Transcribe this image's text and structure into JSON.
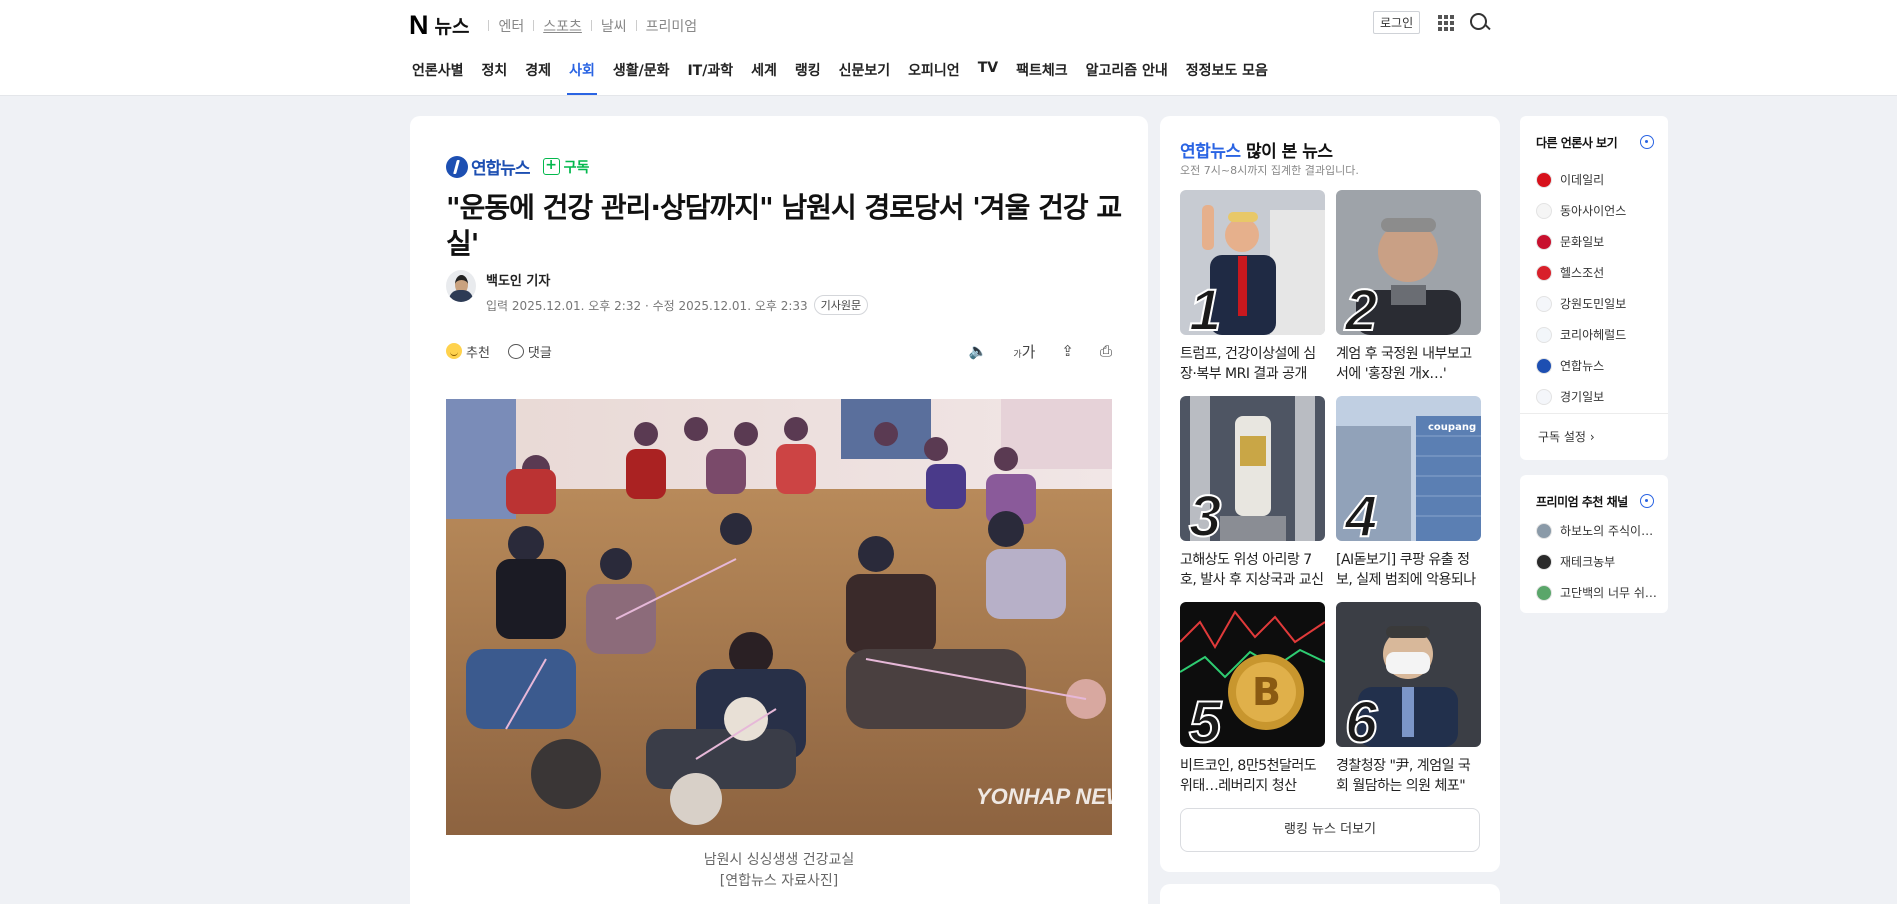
{
  "header": {
    "logo_letter": "N",
    "logo_text": "뉴스",
    "services": [
      "엔터",
      "스포츠",
      "날씨",
      "프리미엄"
    ],
    "login_label": "로그인"
  },
  "nav": {
    "tabs": [
      "언론사별",
      "정치",
      "경제",
      "사회",
      "생활/문화",
      "IT/과학",
      "세계",
      "랭킹",
      "신문보기",
      "오피니언",
      "TV",
      "팩트체크",
      "알고리즘 안내",
      "정정보도 모음"
    ],
    "active": "사회"
  },
  "article": {
    "press_name": "연합뉴스",
    "subscribe_label": "구독",
    "headline": "\"운동에 건강 관리·상담까지\" 남원시 경로당서 '겨울 건강 교실'",
    "reporter": "백도인 기자",
    "input_label": "입력",
    "input_date": "2025.12.01. 오후 2:32",
    "modified_label": "· 수정",
    "modified_date": "2025.12.01. 오후 2:33",
    "original_label": "기사원문",
    "recommend_label": "추천",
    "comment_label": "댓글",
    "font_size_label": "가",
    "photo_watermark": "YONHAP NEWS",
    "caption_line1": "남원시 싱싱생생 건강교실",
    "caption_line2": "[연합뉴스 자료사진]"
  },
  "ranking": {
    "press": "연합뉴스",
    "title_suffix": "많이 본 뉴스",
    "subtitle": "오전 7시~8시까지 집계한 결과입니다.",
    "items": [
      {
        "rank": "1",
        "title": "트럼프, 건강이상설에 심장·복부 MRI 결과 공개"
      },
      {
        "rank": "2",
        "title": "계엄 후 국정원 내부보고서에 '홍장원 개x…'"
      },
      {
        "rank": "3",
        "title": "고해상도 위성 아리랑 7호, 발사 후 지상국과 교신"
      },
      {
        "rank": "4",
        "title": "[AI돋보기] 쿠팡 유출 정보, 실제 범죄에 악용되나"
      },
      {
        "rank": "5",
        "title": "비트코인, 8만5천달러도 위태…레버리지 청산"
      },
      {
        "rank": "6",
        "title": "경찰청장 \"尹, 계엄일 국회 월담하는 의원 체포\""
      }
    ],
    "more_label": "랭킹 뉴스 더보기"
  },
  "sidebar": {
    "other_press_title": "다른 언론사 보기",
    "press_list": [
      {
        "name": "이데일리",
        "color": "#d7111b"
      },
      {
        "name": "동아사이언스",
        "color": "#f5f5f5"
      },
      {
        "name": "문화일보",
        "color": "#c8102e"
      },
      {
        "name": "헬스조선",
        "color": "#d8202a"
      },
      {
        "name": "강원도민일보",
        "color": "#f4f6fa"
      },
      {
        "name": "코리아헤럴드",
        "color": "#f2f6fa"
      },
      {
        "name": "연합뉴스",
        "color": "#1d4fb2"
      },
      {
        "name": "경기일보",
        "color": "#f4f6fa"
      }
    ],
    "settings_label": "구독 설정",
    "premium_title": "프리미엄 추천 채널",
    "premium_list": [
      {
        "name": "하보노의 주식이…",
        "color": "#8a9aa8"
      },
      {
        "name": "재테크농부",
        "color": "#2a2a2a"
      },
      {
        "name": "고단백의 너무 쉬…",
        "color": "#5aa66a"
      }
    ]
  },
  "colors": {
    "accent": "#2a64e3",
    "subscribe": "#03b84d",
    "yonhap": "#1d4fb2",
    "background": "#eff1f5"
  }
}
